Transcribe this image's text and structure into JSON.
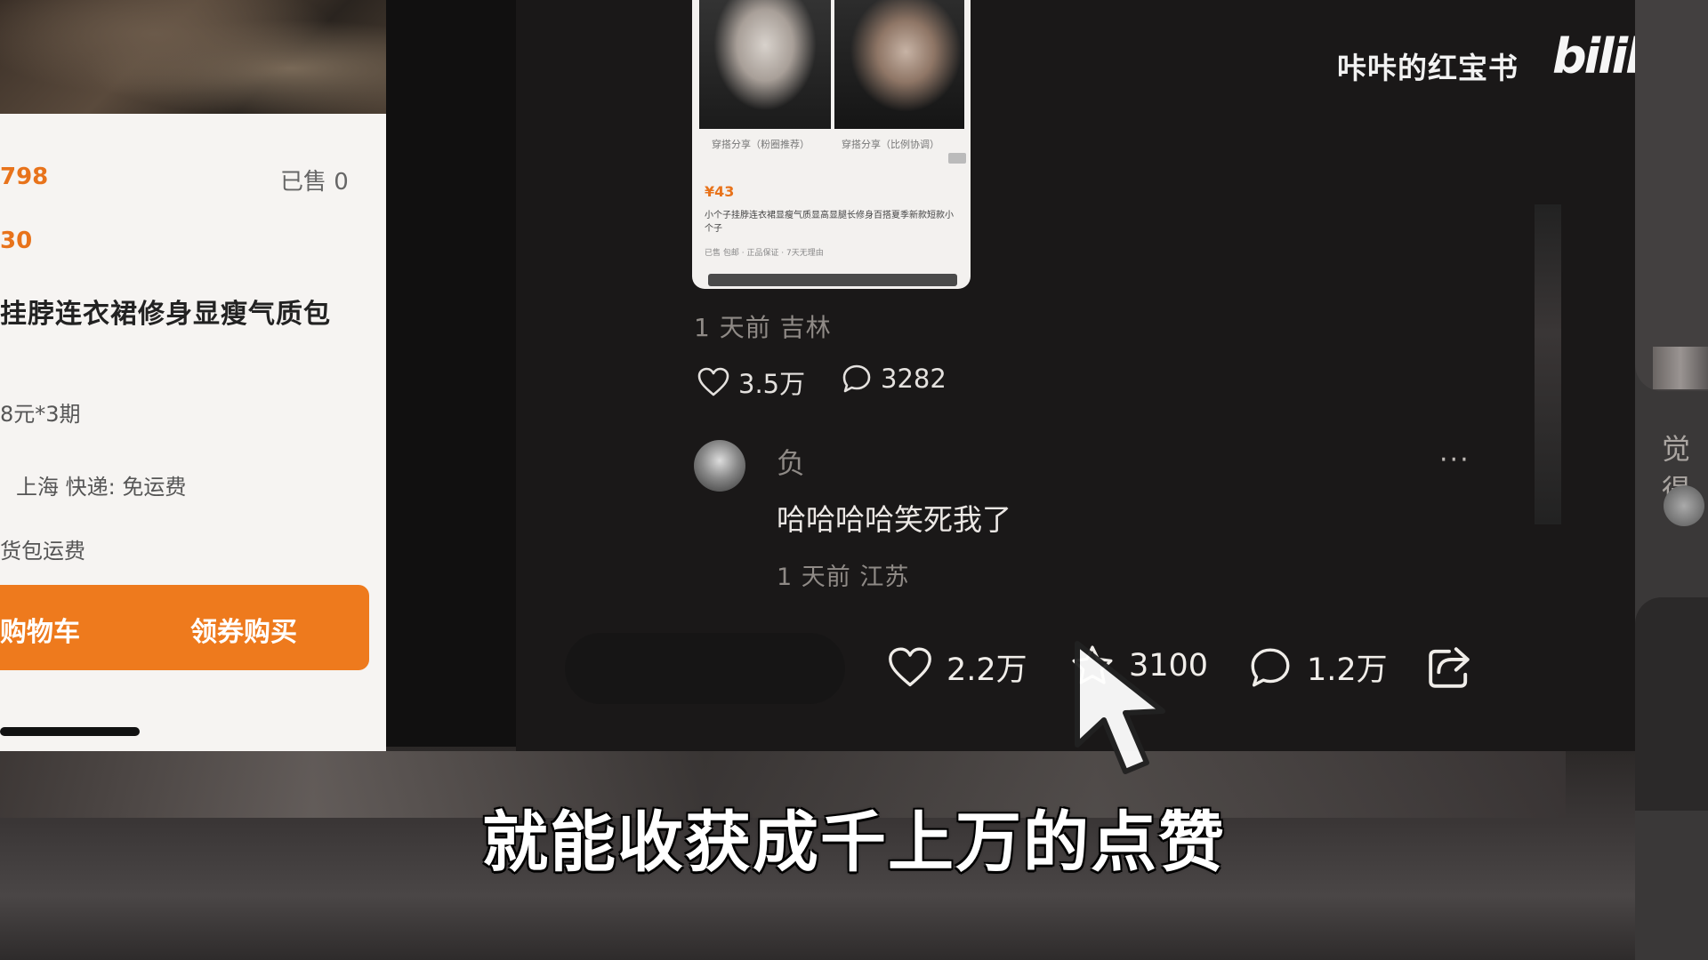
{
  "product_card": {
    "price": "798",
    "sold": "已售 0",
    "coupon": "30",
    "title": "挂脖连衣裙修身显瘦气质包",
    "installment": "8元*3期",
    "shipping_info": "上海  快递: 免运费",
    "freight_insurance": "货包运费",
    "add_to_cart_label": "购物车",
    "coupon_buy_label": "领券购买"
  },
  "post": {
    "thumbnail": {
      "caption_left": "穿搭分享（粉圈推荐）",
      "caption_right": "穿搭分享（比例协调）",
      "price": "¥43",
      "desc": "小个子挂脖连衣裙显瘦气质显高显腿长修身百搭夏季新款短款小个子",
      "meta": "已售  包邮  · 正品保证  · 7天无理由"
    },
    "time_location": "1 天前 吉林",
    "likes": "3.5万",
    "comments": "3282"
  },
  "comment": {
    "author": "负",
    "text": "哈哈哈哈笑死我了",
    "time_location": "1 天前 江苏",
    "more_label": "···"
  },
  "actions": {
    "likes": "2.2万",
    "collects": "3100",
    "comments": "1.2万"
  },
  "watermark": {
    "channel": "咔咔的红宝书",
    "logo": "bilibili"
  },
  "right_panel": {
    "partial_text": "觉得"
  },
  "subtitle": "就能收获成千上万的点赞",
  "colors": {
    "accent_orange": "#ee7a1d",
    "panel_dark": "#1a1818"
  },
  "icons": [
    "heart-icon",
    "comment-icon",
    "star-icon",
    "share-icon",
    "cursor-icon"
  ]
}
